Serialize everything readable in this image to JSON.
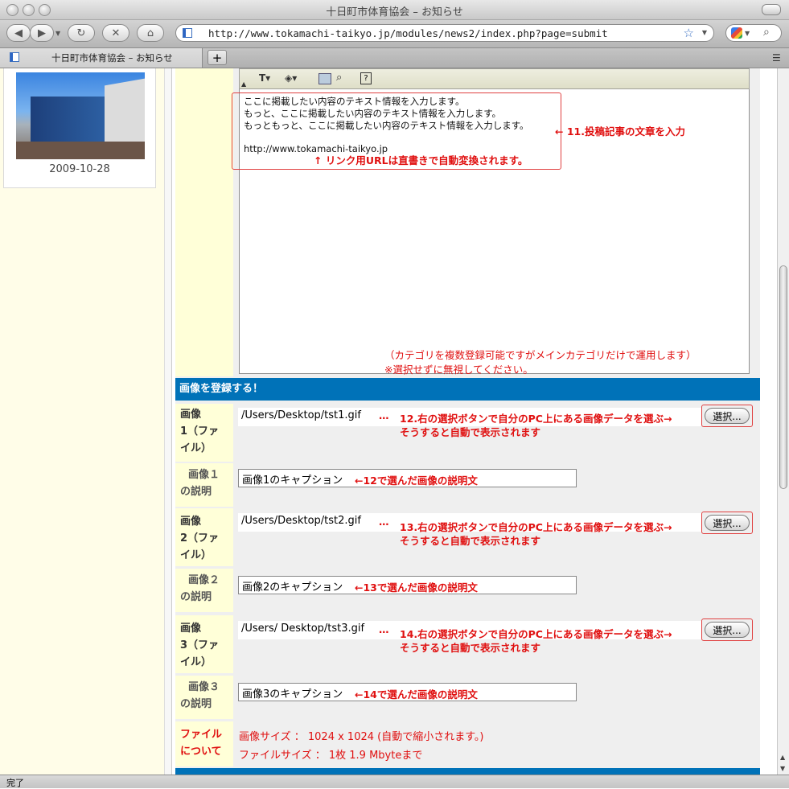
{
  "window": {
    "title": "十日町市体育協会 – お知らせ"
  },
  "browser": {
    "url": "http://www.tokamachi-taikyo.jp/modules/news2/index.php?page=submit",
    "tab_title": "十日町市体育協会 – お知らせ",
    "status": "完了"
  },
  "sidebar": {
    "date": "2009-10-28"
  },
  "editor": {
    "lines": [
      "ここに掲載したい内容のテキスト情報を入力します。",
      "もっと、ここに掲載したい内容のテキスト情報を入力します。",
      "もっともっと、ここに掲載したい内容のテキスト情報を入力します。",
      "",
      "http://www.tokamachi-taikyo.jp"
    ],
    "note_link": "↑ リンク用URLは直書きで自動変換されます。",
    "note_step": "← 11.投稿記事の文章を入力",
    "category_note1": "（カテゴリを複数登録可能ですがメインカテゴリだけで運用します）",
    "category_note2": "※選択せずに無視してください。"
  },
  "images_section": {
    "header": "画像を登録する！",
    "file_rows": [
      {
        "label_lines": [
          "画像",
          "1（ファ",
          "イル）"
        ],
        "path": "/Users/Desktop/tst1.gif",
        "dots": "…",
        "note1": "12.右の選択ボタンで自分のPC上にある画像データを選ぶ→",
        "note2": "そうすると自動で表示されます",
        "button": "選択..."
      },
      {
        "label_lines": [
          "画像",
          "2（ファ",
          "イル）"
        ],
        "path": "/Users/Desktop/tst2.gif",
        "dots": "…",
        "note1": "13.右の選択ボタンで自分のPC上にある画像データを選ぶ→",
        "note2": "そうすると自動で表示されます",
        "button": "選択..."
      },
      {
        "label_lines": [
          "画像",
          "3（ファ",
          "イル）"
        ],
        "path": "/Users/ Desktop/tst3.gif",
        "dots": "…",
        "note1": "14.右の選択ボタンで自分のPC上にある画像データを選ぶ→",
        "note2": "そうすると自動で表示されます",
        "button": "選択..."
      }
    ],
    "caption_rows": [
      {
        "label_lines": [
          "画像１",
          "の説明"
        ],
        "value": "画像1のキャプション",
        "note": "←12で選んだ画像の説明文"
      },
      {
        "label_lines": [
          "画像２",
          "の説明"
        ],
        "value": "画像2のキャプション",
        "note": "←13で選んだ画像の説明文"
      },
      {
        "label_lines": [
          "画像３",
          "の説明"
        ],
        "value": "画像3のキャプション",
        "note": "←14で選んだ画像の説明文"
      }
    ],
    "file_info": {
      "label_lines": [
        "ファイル",
        "について"
      ],
      "size": "画像サイズ ： 1024 x 1024 (自動で縮小されます。)",
      "filesize": "ファイルサイズ ： 1枚 1.9 Mbyteまで"
    }
  },
  "colors": {
    "accent": "#0072b8",
    "annotation": "#e01010",
    "label_bg": "#ffffd8"
  }
}
